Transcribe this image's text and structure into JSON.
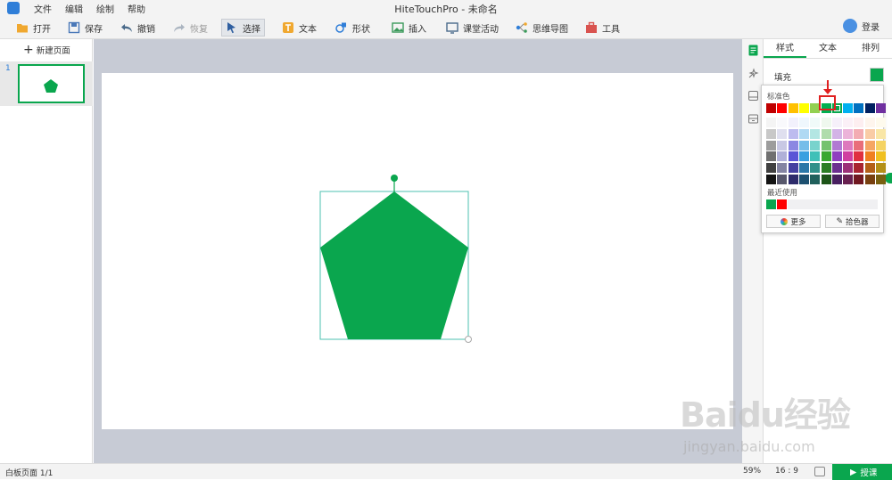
{
  "app": {
    "title": "HiteTouchPro - 未命名",
    "menu": [
      "文件",
      "编辑",
      "绘制",
      "帮助"
    ]
  },
  "toolbar": {
    "open": "打开",
    "save": "保存",
    "undo": "撤销",
    "redo": "恢复",
    "select": "选择",
    "text": "文本",
    "shape": "形状",
    "insert": "插入",
    "activity": "课堂活动",
    "mindmap": "思维导图",
    "tools": "工具",
    "login": "登录"
  },
  "left_panel": {
    "new_page": "新建页面",
    "page_number": "1"
  },
  "right_panel": {
    "tabs": [
      "样式",
      "文本",
      "排列"
    ],
    "fill_label": "填充",
    "fill_color": "#0aa64e"
  },
  "color_popup": {
    "standard_label": "标准色",
    "recent_label": "最近使用",
    "more_label": "更多",
    "picker_label": "拾色器",
    "standard_colors": [
      "#c00000",
      "#ff0000",
      "#ffc000",
      "#ffff00",
      "#92d050",
      "#00b050",
      "#0aa64e",
      "#00b0f0",
      "#0070c0",
      "#002060",
      "#7030a0"
    ],
    "recent_colors": [
      "#0aa64e",
      "#ff0000"
    ],
    "selected_color": "#0aa64e"
  },
  "shape": {
    "fill": "#0aa64e"
  },
  "status": {
    "page_info": "白板页面 1/1",
    "zoom": "59%",
    "ratio": "16 : 9",
    "play": "授课"
  },
  "watermark": {
    "brand": "Baidu经验",
    "url": "jingyan.baidu.com"
  }
}
